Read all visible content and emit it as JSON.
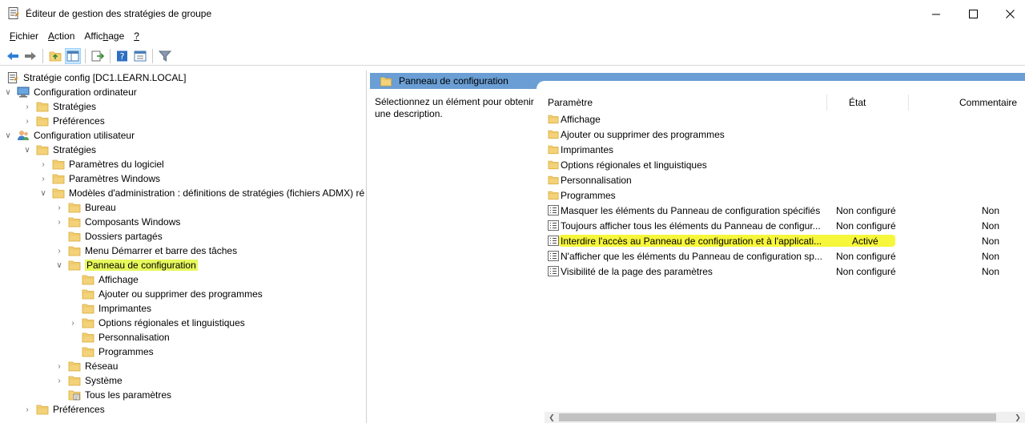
{
  "window": {
    "title": "Éditeur de gestion des stratégies de groupe",
    "min_icon": "minimize-icon",
    "max_icon": "maximize-icon",
    "close_icon": "close-icon"
  },
  "menu": [
    {
      "pre": "",
      "u": "F",
      "post": "ichier"
    },
    {
      "pre": "",
      "u": "A",
      "post": "ction"
    },
    {
      "pre": "Affic",
      "u": "h",
      "post": "age"
    },
    {
      "pre": "",
      "u": "?",
      "post": ""
    }
  ],
  "toolbar": {
    "icons": [
      "back-arrow-icon",
      "forward-arrow-icon",
      "up-folder-icon",
      "show-tree-icon",
      "export-list-icon",
      "help-icon",
      "properties-icon",
      "filter-icon"
    ]
  },
  "tree": {
    "root": "Stratégie config [DC1.LEARN.LOCAL]",
    "computer_config": "Configuration ordinateur",
    "computer_strategies": "Stratégies",
    "computer_preferences": "Préférences",
    "user_config": "Configuration utilisateur",
    "user_strategies": "Stratégies",
    "software_settings": "Paramètres du logiciel",
    "windows_settings": "Paramètres Windows",
    "admin_templates": "Modèles d'administration : définitions de stratégies (fichiers ADMX) ré",
    "desktop": "Bureau",
    "windows_components": "Composants Windows",
    "shared_folders": "Dossiers partagés",
    "start_menu": "Menu Démarrer et barre des tâches",
    "control_panel": "Panneau de configuration",
    "cp_display": "Affichage",
    "cp_add_remove": "Ajouter ou supprimer des programmes",
    "cp_printers": "Imprimantes",
    "cp_regional": "Options régionales et linguistiques",
    "cp_personalization": "Personnalisation",
    "cp_programs": "Programmes",
    "network": "Réseau",
    "system": "Système",
    "all_settings": "Tous les paramètres",
    "user_preferences": "Préférences"
  },
  "right": {
    "header": "Panneau de configuration",
    "description": "Sélectionnez un élément pour obtenir une description.",
    "columns": {
      "setting": "Paramètre",
      "state": "État",
      "comment": "Commentaire"
    },
    "folders": [
      "Affichage",
      "Ajouter ou supprimer des programmes",
      "Imprimantes",
      "Options régionales et linguistiques",
      "Personnalisation",
      "Programmes"
    ],
    "policies": [
      {
        "name": "Masquer les éléments du Panneau de configuration spécifiés",
        "state": "Non configuré",
        "comment": "Non"
      },
      {
        "name": "Toujours afficher tous les éléments du Panneau de configur...",
        "state": "Non configuré",
        "comment": "Non"
      },
      {
        "name": "Interdire l'accès au Panneau de configuration et à l'applicati...",
        "state": "Activé",
        "comment": "Non"
      },
      {
        "name": "N'afficher que les éléments du Panneau de configuration sp...",
        "state": "Non configuré",
        "comment": "Non"
      },
      {
        "name": "Visibilité de la page des paramètres",
        "state": "Non configuré",
        "comment": "Non"
      }
    ]
  },
  "colors": {
    "highlight": "#f6f63b",
    "header_blue": "#6a9ed4",
    "folder": "#f3d27a"
  }
}
